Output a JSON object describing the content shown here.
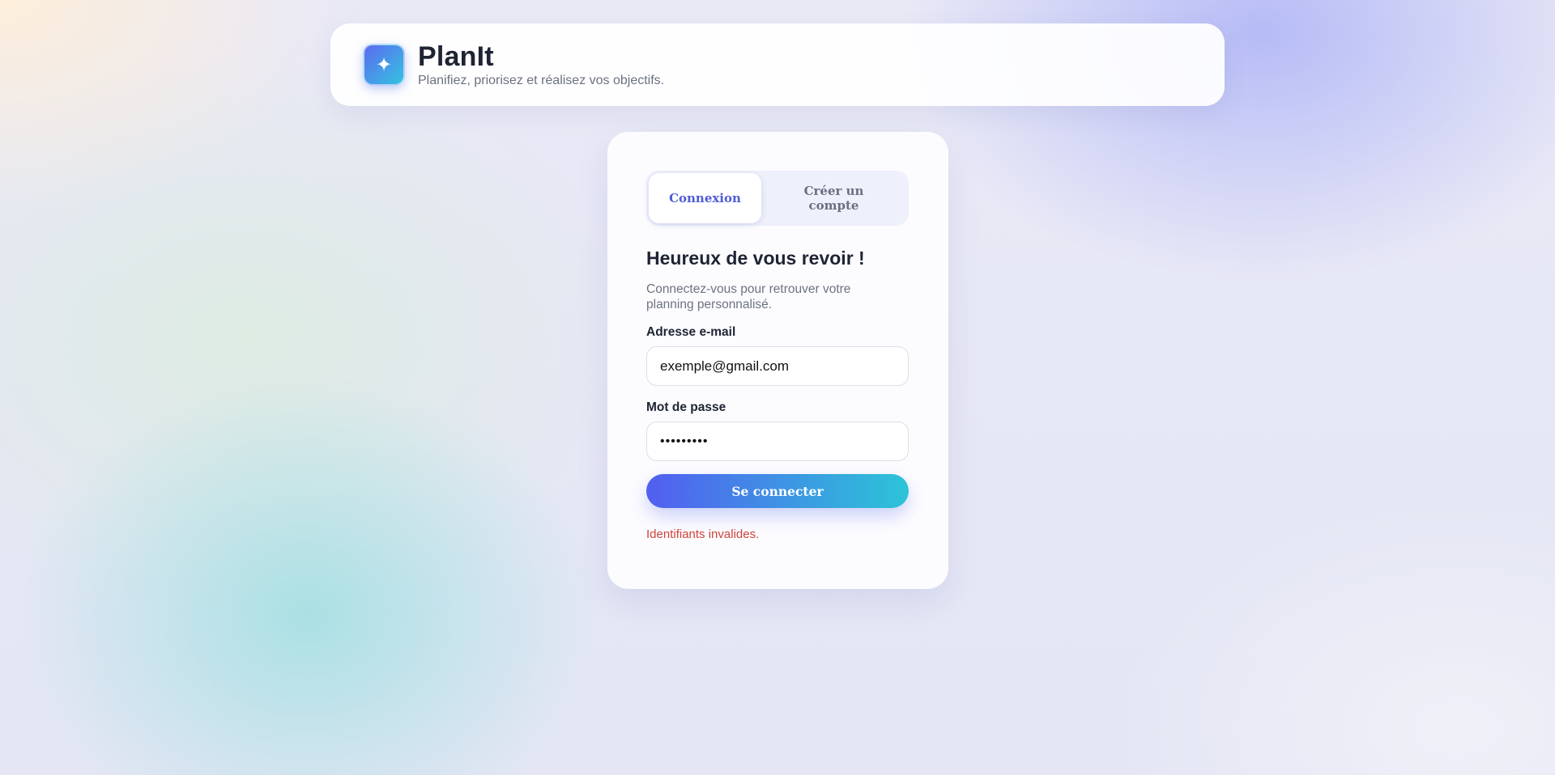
{
  "app": {
    "logo_icon": "sparkle-icon",
    "logo_glyph": "✦",
    "name": "PlanIt",
    "tagline": "Planifiez, priorisez et réalisez vos objectifs."
  },
  "auth": {
    "tabs": [
      {
        "label": "Connexion",
        "active": true
      },
      {
        "label": "Créer un compte",
        "active": false
      }
    ],
    "title": "Heureux de vous revoir !",
    "subtitle": "Connectez-vous pour retrouver votre planning personnalisé.",
    "email": {
      "label": "Adresse e-mail",
      "value": "exemple@gmail.com"
    },
    "password": {
      "label": "Mot de passe",
      "value": "•••••••••"
    },
    "submit_label": "Se connecter",
    "error": "Identifiants invalides."
  },
  "colors": {
    "accent": "#4f5bd5",
    "button_gradient_start": "#525ef0",
    "button_gradient_end": "#2cc4d8",
    "error": "#d0433a"
  }
}
